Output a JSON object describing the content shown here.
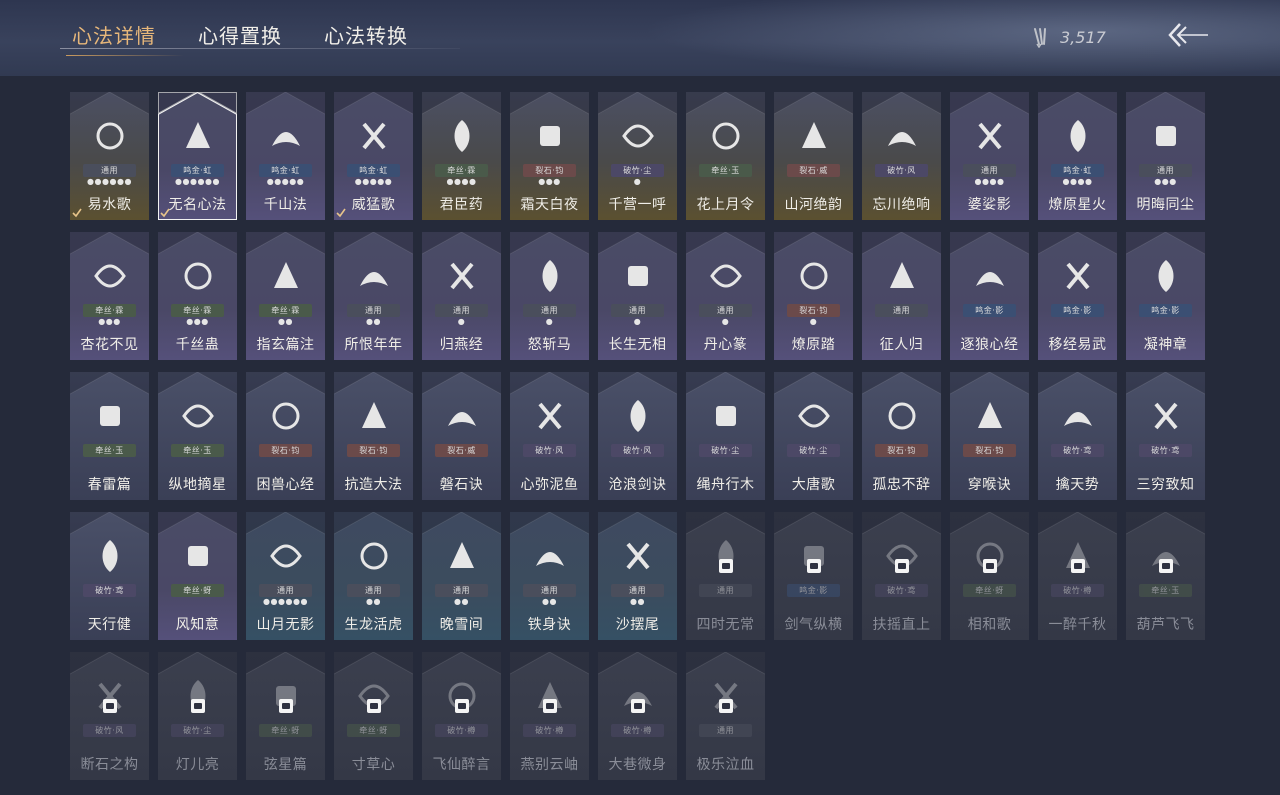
{
  "header": {
    "tabs": [
      {
        "label": "心法详情",
        "active": true
      },
      {
        "label": "心得置换",
        "active": false
      },
      {
        "label": "心法转换",
        "active": false
      }
    ],
    "currency": {
      "icon": "feather-arrows-icon",
      "amount": "3,517"
    },
    "back_icon": "back-arrow-icon"
  },
  "colors": {
    "active_tab": "#e7b77a",
    "tag_blue": "#3b4f73",
    "tag_red": "#6b4a4a",
    "tag_green": "#4a5a4a",
    "tag_purple": "#4c4866",
    "tag_gray": "#4a4e5c"
  },
  "cards": [
    {
      "name": "易水歌",
      "tag": "通用",
      "tone": "gray",
      "dots": "●●●●●●",
      "style": "gold",
      "icon": "horse-icon",
      "checked": true,
      "locked": false
    },
    {
      "name": "无名心法",
      "tag": "鸣金·虹",
      "tone": "blue",
      "dots": "●●●●●●",
      "style": "purple",
      "icon": "axe-icon",
      "checked": true,
      "locked": false,
      "selected": true
    },
    {
      "name": "千山法",
      "tag": "鸣金·虹",
      "tone": "blue",
      "dots": "●●●●●",
      "style": "purple",
      "icon": "mountain-icon",
      "checked": false,
      "locked": false
    },
    {
      "name": "威猛歌",
      "tag": "鸣金·虹",
      "tone": "blue",
      "dots": "●●●●●",
      "style": "purple",
      "icon": "fist-icon",
      "checked": true,
      "locked": false
    },
    {
      "name": "君臣药",
      "tag": "牵丝·霖",
      "tone": "green",
      "dots": "●●●●",
      "style": "gold",
      "icon": "herb-pot-icon",
      "checked": false,
      "locked": false
    },
    {
      "name": "霜天白夜",
      "tag": "裂石·钧",
      "tone": "red",
      "dots": "●●●",
      "style": "gold",
      "icon": "spear-icon",
      "checked": false,
      "locked": false
    },
    {
      "name": "千营一呼",
      "tag": "破竹·尘",
      "tone": "purple",
      "dots": "●",
      "style": "gold",
      "icon": "flag-icon",
      "checked": false,
      "locked": false
    },
    {
      "name": "花上月令",
      "tag": "牵丝·玉",
      "tone": "green",
      "dots": "",
      "style": "gold",
      "icon": "flower-moon-icon",
      "checked": false,
      "locked": false
    },
    {
      "name": "山河绝韵",
      "tag": "裂石·威",
      "tone": "red",
      "dots": "",
      "style": "gold",
      "icon": "landscape-icon",
      "checked": false,
      "locked": false
    },
    {
      "name": "忘川绝响",
      "tag": "破竹·风",
      "tone": "purple",
      "dots": "",
      "style": "gold",
      "icon": "mask-icon",
      "checked": false,
      "locked": false
    },
    {
      "name": "婆娑影",
      "tag": "通用",
      "tone": "gray",
      "dots": "●●●●",
      "style": "purple",
      "icon": "dragon-icon",
      "checked": false,
      "locked": false
    },
    {
      "name": "燎原星火",
      "tag": "鸣金·虹",
      "tone": "blue",
      "dots": "●●●●",
      "style": "purple",
      "icon": "scythe-icon",
      "checked": false,
      "locked": false
    },
    {
      "name": "明晦同尘",
      "tag": "通用",
      "tone": "gray",
      "dots": "●●●",
      "style": "purple",
      "icon": "serpent-staff-icon",
      "checked": false,
      "locked": false
    },
    {
      "name": "杏花不见",
      "tag": "牵丝·霖",
      "tone": "green",
      "dots": "●●●",
      "style": "purple",
      "icon": "blossom-icon",
      "checked": false,
      "locked": false
    },
    {
      "name": "千丝蛊",
      "tag": "牵丝·霖",
      "tone": "green",
      "dots": "●●●",
      "style": "purple",
      "icon": "leaf-icon",
      "checked": false,
      "locked": false
    },
    {
      "name": "指玄篇注",
      "tag": "牵丝·霖",
      "tone": "green",
      "dots": "●●",
      "style": "purple",
      "icon": "yin-yang-icon",
      "checked": false,
      "locked": false
    },
    {
      "name": "所恨年年",
      "tag": "通用",
      "tone": "gray",
      "dots": "●●",
      "style": "purple",
      "icon": "willow-icon",
      "checked": false,
      "locked": false
    },
    {
      "name": "归燕经",
      "tag": "通用",
      "tone": "gray",
      "dots": "●",
      "style": "purple",
      "icon": "swallow-icon",
      "checked": false,
      "locked": false
    },
    {
      "name": "怒斩马",
      "tag": "通用",
      "tone": "gray",
      "dots": "●",
      "style": "purple",
      "icon": "blade-icon",
      "checked": false,
      "locked": false
    },
    {
      "name": "长生无相",
      "tag": "通用",
      "tone": "gray",
      "dots": "●",
      "style": "purple",
      "icon": "statue-icon",
      "checked": false,
      "locked": false
    },
    {
      "name": "丹心篆",
      "tag": "通用",
      "tone": "gray",
      "dots": "●",
      "style": "purple",
      "icon": "hand-blade-icon",
      "checked": false,
      "locked": false
    },
    {
      "name": "燎原踏",
      "tag": "裂石·钧",
      "tone": "red",
      "dots": "●",
      "style": "purple",
      "icon": "rearing-horse-icon",
      "checked": false,
      "locked": false
    },
    {
      "name": "征人归",
      "tag": "通用",
      "tone": "gray",
      "dots": "",
      "style": "purple",
      "icon": "bird-hand-icon",
      "checked": false,
      "locked": false
    },
    {
      "name": "逐狼心经",
      "tag": "鸣金·影",
      "tone": "blue",
      "dots": "",
      "style": "purple",
      "icon": "wolf-icon",
      "checked": false,
      "locked": false
    },
    {
      "name": "移经易武",
      "tag": "鸣金·影",
      "tone": "blue",
      "dots": "",
      "style": "purple",
      "icon": "armor-icon",
      "checked": false,
      "locked": false
    },
    {
      "name": "凝神章",
      "tag": "鸣金·影",
      "tone": "blue",
      "dots": "",
      "style": "purple",
      "icon": "bow-icon",
      "checked": false,
      "locked": false
    },
    {
      "name": "春雷篇",
      "tag": "牵丝·玉",
      "tone": "green",
      "dots": "",
      "style": "plain",
      "icon": "storm-tree-icon",
      "checked": false,
      "locked": false
    },
    {
      "name": "纵地摘星",
      "tag": "牵丝·玉",
      "tone": "green",
      "dots": "",
      "style": "plain",
      "icon": "star-orbit-icon",
      "checked": false,
      "locked": false
    },
    {
      "name": "困兽心经",
      "tag": "裂石·钧",
      "tone": "red",
      "dots": "",
      "style": "plain",
      "icon": "shackle-icon",
      "checked": false,
      "locked": false
    },
    {
      "name": "抗造大法",
      "tag": "裂石·钧",
      "tone": "red",
      "dots": "",
      "style": "plain",
      "icon": "bell-icon",
      "checked": false,
      "locked": false
    },
    {
      "name": "磐石诀",
      "tag": "裂石·威",
      "tone": "red",
      "dots": "",
      "style": "plain",
      "icon": "rock-icon",
      "checked": false,
      "locked": false
    },
    {
      "name": "心弥泥鱼",
      "tag": "破竹·风",
      "tone": "purple",
      "dots": "",
      "style": "plain",
      "icon": "fish-icon",
      "checked": false,
      "locked": false
    },
    {
      "name": "沧浪剑诀",
      "tag": "破竹·风",
      "tone": "purple",
      "dots": "",
      "style": "plain",
      "icon": "water-dragon-icon",
      "checked": false,
      "locked": false
    },
    {
      "name": "绳舟行木",
      "tag": "破竹·尘",
      "tone": "purple",
      "dots": "",
      "style": "plain",
      "icon": "tree-root-icon",
      "checked": false,
      "locked": false
    },
    {
      "name": "大唐歌",
      "tag": "破竹·尘",
      "tone": "purple",
      "dots": "",
      "style": "plain",
      "icon": "city-wall-icon",
      "checked": false,
      "locked": false
    },
    {
      "name": "孤忠不辞",
      "tag": "裂石·钧",
      "tone": "red",
      "dots": "",
      "style": "plain",
      "icon": "crossed-swords-icon",
      "checked": false,
      "locked": false
    },
    {
      "name": "穿喉诀",
      "tag": "裂石·钧",
      "tone": "red",
      "dots": "",
      "style": "plain",
      "icon": "moon-cut-icon",
      "checked": false,
      "locked": false
    },
    {
      "name": "擒天势",
      "tag": "破竹·鸢",
      "tone": "purple",
      "dots": "",
      "style": "plain",
      "icon": "chain-fist-icon",
      "checked": false,
      "locked": false
    },
    {
      "name": "三穷致知",
      "tag": "破竹·鸢",
      "tone": "purple",
      "dots": "",
      "style": "plain",
      "icon": "scroll-icon",
      "checked": false,
      "locked": false
    },
    {
      "name": "天行健",
      "tag": "破竹·鸢",
      "tone": "purple",
      "dots": "",
      "style": "plain",
      "icon": "umbrella-icon",
      "checked": false,
      "locked": false
    },
    {
      "name": "风知意",
      "tag": "牵丝·蚜",
      "tone": "green",
      "dots": "",
      "style": "purple",
      "icon": "fan-icon",
      "checked": false,
      "locked": false
    },
    {
      "name": "山月无影",
      "tag": "通用",
      "tone": "gray",
      "dots": "●●●●●●",
      "style": "blue",
      "icon": "claw-slash-icon",
      "checked": false,
      "locked": false
    },
    {
      "name": "生龙活虎",
      "tag": "通用",
      "tone": "gray",
      "dots": "●●",
      "style": "blue",
      "icon": "crossed-fish-icon",
      "checked": false,
      "locked": false
    },
    {
      "name": "晚雪间",
      "tag": "通用",
      "tone": "gray",
      "dots": "●●",
      "style": "blue",
      "icon": "cross-sword-icon",
      "checked": false,
      "locked": false
    },
    {
      "name": "铁身诀",
      "tag": "通用",
      "tone": "gray",
      "dots": "●●",
      "style": "blue",
      "icon": "muscle-icon",
      "checked": false,
      "locked": false
    },
    {
      "name": "沙摆尾",
      "tag": "通用",
      "tone": "gray",
      "dots": "●●",
      "style": "blue",
      "icon": "wave-tail-icon",
      "checked": false,
      "locked": false
    },
    {
      "name": "四时无常",
      "tag": "通用",
      "tone": "gray",
      "dots": "",
      "style": "locked",
      "icon": "bird-branch-icon",
      "checked": false,
      "locked": true
    },
    {
      "name": "剑气纵横",
      "tag": "鸣金·影",
      "tone": "blue",
      "dots": "",
      "style": "locked",
      "icon": "sword-swirl-icon",
      "checked": false,
      "locked": true
    },
    {
      "name": "扶摇直上",
      "tag": "破竹·鸢",
      "tone": "purple",
      "dots": "",
      "style": "locked",
      "icon": "eagle-icon",
      "checked": false,
      "locked": true
    },
    {
      "name": "相和歌",
      "tag": "牵丝·蚜",
      "tone": "green",
      "dots": "",
      "style": "locked",
      "icon": "ribbon-icon",
      "checked": false,
      "locked": true
    },
    {
      "name": "一醉千秋",
      "tag": "破竹·樽",
      "tone": "purple",
      "dots": "",
      "style": "locked",
      "icon": "wine-icon",
      "checked": false,
      "locked": true
    },
    {
      "name": "葫芦飞飞",
      "tag": "牵丝·玉",
      "tone": "green",
      "dots": "",
      "style": "locked",
      "icon": "gourd-icon",
      "checked": false,
      "locked": true
    },
    {
      "name": "断石之构",
      "tag": "破竹·风",
      "tone": "purple",
      "dots": "",
      "style": "locked",
      "icon": "warrior-icon",
      "checked": false,
      "locked": true
    },
    {
      "name": "灯儿亮",
      "tag": "破竹·尘",
      "tone": "purple",
      "dots": "",
      "style": "locked",
      "icon": "lantern-icon",
      "checked": false,
      "locked": true
    },
    {
      "name": "弦星篇",
      "tag": "牵丝·蚜",
      "tone": "green",
      "dots": "",
      "style": "locked",
      "icon": "zither-icon",
      "checked": false,
      "locked": true
    },
    {
      "name": "寸草心",
      "tag": "牵丝·蚜",
      "tone": "green",
      "dots": "",
      "style": "locked",
      "icon": "sprout-icon",
      "checked": false,
      "locked": true
    },
    {
      "name": "飞仙醉言",
      "tag": "破竹·樽",
      "tone": "purple",
      "dots": "",
      "style": "locked",
      "icon": "jar-icon",
      "checked": false,
      "locked": true
    },
    {
      "name": "燕别云岫",
      "tag": "破竹·樽",
      "tone": "purple",
      "dots": "",
      "style": "locked",
      "icon": "swallow-cloud-icon",
      "checked": false,
      "locked": true
    },
    {
      "name": "大巷微身",
      "tag": "破竹·樽",
      "tone": "purple",
      "dots": "",
      "style": "locked",
      "icon": "pipe-icon",
      "checked": false,
      "locked": true
    },
    {
      "name": "极乐泣血",
      "tag": "通用",
      "tone": "gray",
      "dots": "",
      "style": "locked",
      "icon": "moth-icon",
      "checked": false,
      "locked": true
    }
  ]
}
